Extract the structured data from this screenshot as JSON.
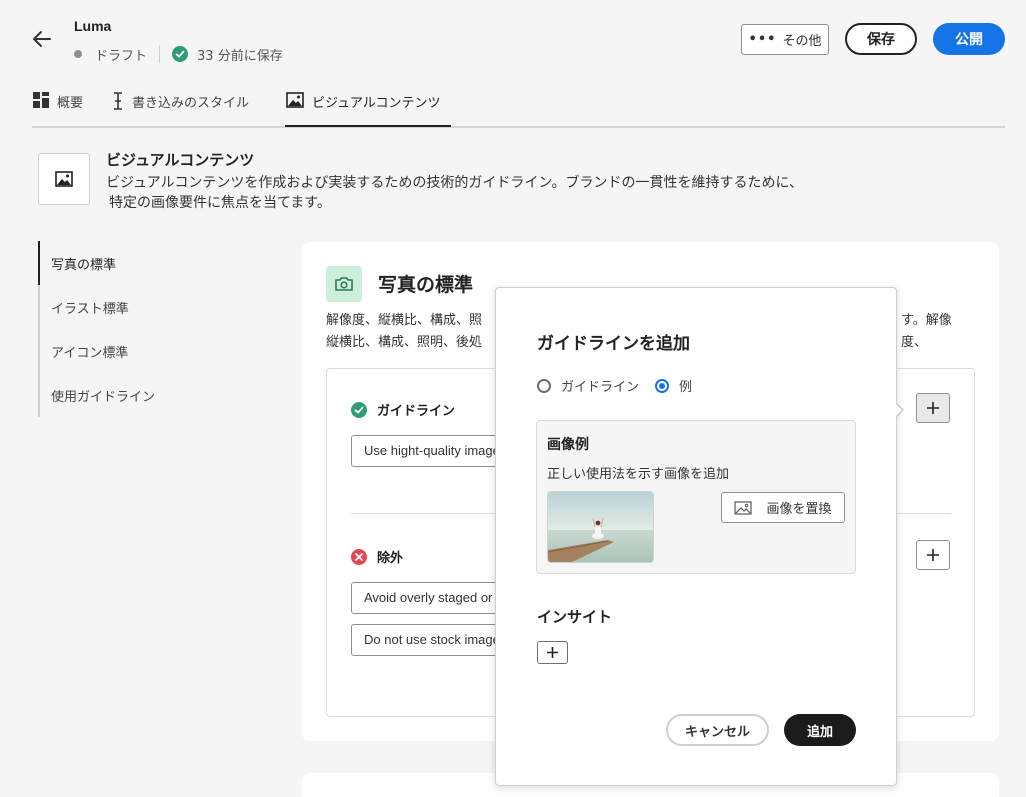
{
  "header": {
    "app_title": "Luma",
    "status_draft": "ドラフト",
    "status_saved": "33 分前に保存",
    "more_label": "その他",
    "save_label": "保存",
    "publish_label": "公開"
  },
  "tabs": [
    {
      "label": "概要",
      "icon": "dashboard-icon"
    },
    {
      "label": "書き込みのスタイル",
      "icon": "text-cursor-icon"
    },
    {
      "label": "ビジュアルコンテンツ",
      "icon": "image-icon",
      "active": true
    }
  ],
  "section": {
    "title": "ビジュアルコンテンツ",
    "description": "ビジュアルコンテンツを作成および実装するための技術的ガイドライン。ブランドの一貫性を維持するために、特定の画像要件に焦点を当てます。",
    "description_line1": "ビジュアルコンテンツを作成および実装するための技術的ガイドライン。ブランドの一貫性を維持するために、",
    "description_line2": "特定の画像要件に焦点を当てます。"
  },
  "left_nav": [
    {
      "label": "写真の標準",
      "active": true
    },
    {
      "label": "イラスト標準"
    },
    {
      "label": "アイコン標準"
    },
    {
      "label": "使用ガイドライン"
    }
  ],
  "card": {
    "title": "写真の標準",
    "desc_line1_left": "解像度、縦横比、構成、照",
    "desc_line1_right": "す。解像度、",
    "desc_line2_left": "縦横比、構成、照明、後処",
    "guidelines_header": "ガイドライン",
    "guideline_value": "Use hight-quality images",
    "exclusions_header": "除外",
    "exclusion_value_1": "Avoid overly staged or u",
    "exclusion_value_2": "Do not use stock images"
  },
  "popover": {
    "title": "ガイドラインを追加",
    "radio_guideline": "ガイドライン",
    "radio_example": "例",
    "selected": "例",
    "example_title": "画像例",
    "example_desc": "正しい使用法を示す画像を追加",
    "replace_label": "画像を置換",
    "insight_title": "インサイト",
    "cancel_label": "キャンセル",
    "add_label": "追加"
  },
  "colors": {
    "accent_blue": "#1473e6",
    "success_green": "#2d9d78",
    "error_red": "#e34850",
    "icon_bg_green": "#cbefdc"
  }
}
